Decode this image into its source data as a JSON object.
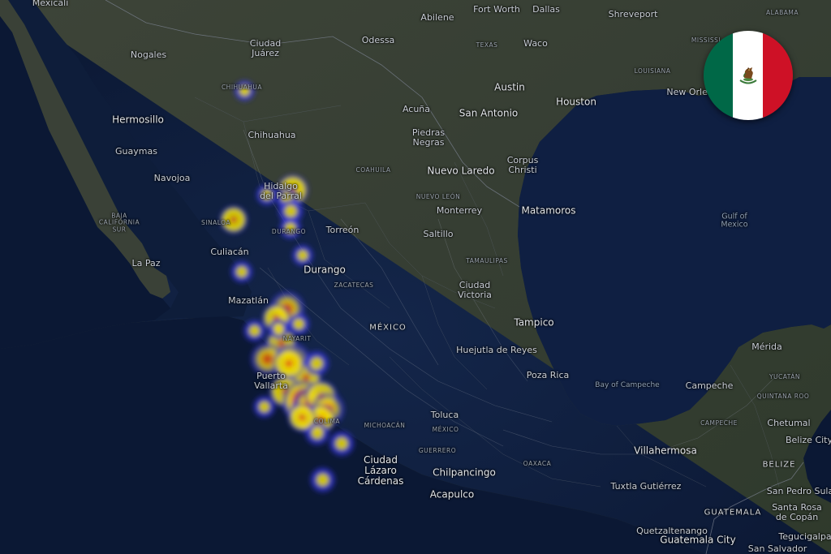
{
  "map": {
    "region": "Mexico",
    "flag": {
      "name": "mexico-flag",
      "colors": {
        "green": "#006847",
        "white": "#ffffff",
        "red": "#ce1126"
      }
    },
    "heat_colors": {
      "low": "#3535e0",
      "mid": "#f0e000",
      "high": "#e01818",
      "peak": "#8c0a18"
    },
    "labels": {
      "mexicali": "Mexicali",
      "odessa": "Odessa",
      "abilene": "Abilene",
      "fort_worth": "Fort Worth",
      "dallas": "Dallas",
      "shreveport": "Shreveport",
      "alabama": "ALABAMA",
      "mississippi": "MISSISSI",
      "texas": "TEXAS",
      "waco": "Waco",
      "louisiana": "LOUISIANA",
      "new_orleans": "New Orlea",
      "ciudad_juarez_1": "Ciudad",
      "ciudad_juarez_2": "Juárez",
      "nogales": "Nogales",
      "chihuahua_state": "CHIHUAHUA",
      "austin": "Austin",
      "houston": "Houston",
      "san_antonio": "San Antonio",
      "hermosillo": "Hermosillo",
      "chihuahua": "Chihuahua",
      "acuna": "Acuña",
      "piedras_negras_1": "Piedras",
      "piedras_negras_2": "Negras",
      "guaymas": "Guaymas",
      "navojoa": "Navojoa",
      "coahuila": "COAHUILA",
      "nuevo_laredo": "Nuevo Laredo",
      "corpus_christi_1": "Corpus",
      "corpus_christi_2": "Christi",
      "hidalgo_parral_1": "Hidalgo",
      "hidalgo_parral_2": "del Parral",
      "nuevo_leon": "NUEVO LEÓN",
      "monterrey": "Monterrey",
      "matamoros": "Matamoros",
      "baja_california_sur_1": "BAJA",
      "baja_california_sur_2": "CALIFORNIA",
      "baja_california_sur_3": "SUR",
      "sinaloa": "SINALOA",
      "torreon": "Torreón",
      "durango_state": "DURANGO",
      "saltillo": "Saltillo",
      "gulf_of_mexico_1": "Gulf of",
      "gulf_of_mexico_2": "Mexico",
      "culiacan": "Culiacán",
      "tamaulipas": "TAMAULIPAS",
      "la_paz": "La Paz",
      "durango": "Durango",
      "zacatecas": "ZACATECAS",
      "ciudad_victoria_1": "Ciudad",
      "ciudad_victoria_2": "Victoria",
      "mazatlan": "Mazatlán",
      "tampico": "Tampico",
      "mexico_country": "MÉXICO",
      "nayarit": "NAYARIT",
      "huejutla": "Huejutla de Reyes",
      "merida": "Mérida",
      "puerto_vallarta_1": "Puerto",
      "puerto_vallarta_2": "Vallarta",
      "poza_rica": "Poza Rica",
      "yucatan": "YUCATÁN",
      "bay_of_campeche": "Bay of Campeche",
      "campeche": "Campeche",
      "quintana_roo": "QUINTANA ROO",
      "toluca": "Toluca",
      "colima": "COLIMA",
      "michoacan": "MICHOACÁN",
      "mexico_state": "MÉXICO",
      "campeche_state": "CAMPECHE",
      "chetumal": "Chetumal",
      "belize_city": "Belize City",
      "guerrero": "GUERRERO",
      "villahermosa": "Villahermosa",
      "ciudad_lazaro_1": "Ciudad",
      "ciudad_lazaro_2": "Lázaro",
      "ciudad_lazaro_3": "Cárdenas",
      "chilpancingo": "Chilpancingo",
      "belize": "BELIZE",
      "tuxtla_gutierrez": "Tuxtla Gutiérrez",
      "acapulco": "Acapulco",
      "san_pedro_sula": "San Pedro Sula",
      "oaxaca": "OAXACA",
      "guatemala": "GUATEMALA",
      "santa_rosa_copan_1": "Santa Rosa",
      "santa_rosa_copan_2": "de Copán",
      "quetzaltenango": "Quetzaltenango",
      "guatemala_city": "Guatemala City",
      "tegucigalpa": "Tegucigalpa",
      "san_salvador": "San Salvador"
    }
  },
  "heat_points": [
    {
      "name": "chihuahua",
      "lon": -106.08,
      "lat": 28.63,
      "level": 0.1
    },
    {
      "name": "torreon",
      "lon": -103.42,
      "lat": 25.54,
      "level": 0.12
    },
    {
      "name": "monterrey",
      "lon": -100.32,
      "lat": 25.68,
      "level": 0.55
    },
    {
      "name": "saltillo",
      "lon": -100.99,
      "lat": 25.43,
      "level": 0.2
    },
    {
      "name": "monterrey-south",
      "lon": -100.55,
      "lat": 25.05,
      "level": 0.3
    },
    {
      "name": "linares",
      "lon": -100.6,
      "lat": 24.55,
      "level": 0.15
    },
    {
      "name": "culiacan",
      "lon": -107.39,
      "lat": 24.8,
      "level": 0.4
    },
    {
      "name": "mazatlan",
      "lon": -106.42,
      "lat": 23.25,
      "level": 0.15
    },
    {
      "name": "ciudad-victoria",
      "lon": -99.13,
      "lat": 23.74,
      "level": 0.12
    },
    {
      "name": "san-luis-potosi",
      "lon": -100.98,
      "lat": 22.15,
      "level": 0.75
    },
    {
      "name": "aguascalientes",
      "lon": -102.29,
      "lat": 21.88,
      "level": 0.4
    },
    {
      "name": "leon",
      "lon": -101.68,
      "lat": 21.12,
      "level": 0.55
    },
    {
      "name": "queretaro",
      "lon": -100.39,
      "lat": 20.59,
      "level": 0.88
    },
    {
      "name": "pachuca",
      "lon": -98.73,
      "lat": 20.1,
      "level": 0.55
    },
    {
      "name": "guadalajara",
      "lon": -103.35,
      "lat": 20.66,
      "level": 0.68
    },
    {
      "name": "tepic",
      "lon": -104.89,
      "lat": 21.5,
      "level": 0.15
    },
    {
      "name": "morelia",
      "lon": -101.19,
      "lat": 19.7,
      "level": 0.6
    },
    {
      "name": "colima",
      "lon": -103.72,
      "lat": 19.24,
      "level": 0.15
    },
    {
      "name": "toluca",
      "lon": -99.66,
      "lat": 19.29,
      "level": 0.5
    },
    {
      "name": "mexico-city",
      "lon": -99.13,
      "lat": 19.43,
      "level": 1.0
    },
    {
      "name": "puebla",
      "lon": -98.21,
      "lat": 19.04,
      "level": 0.98
    },
    {
      "name": "tlaxcala",
      "lon": -98.24,
      "lat": 19.32,
      "level": 0.75
    },
    {
      "name": "xalapa",
      "lon": -96.91,
      "lat": 19.54,
      "level": 0.6
    },
    {
      "name": "veracruz",
      "lon": -96.13,
      "lat": 19.17,
      "level": 0.7
    },
    {
      "name": "cordoba",
      "lon": -96.93,
      "lat": 18.88,
      "level": 0.45
    },
    {
      "name": "poza-rica",
      "lon": -97.46,
      "lat": 20.53,
      "level": 0.3
    },
    {
      "name": "tehuacan",
      "lon": -97.39,
      "lat": 18.46,
      "level": 0.25
    },
    {
      "name": "coatzacoalcos",
      "lon": -94.46,
      "lat": 18.15,
      "level": 0.3
    },
    {
      "name": "oaxaca",
      "lon": -96.73,
      "lat": 17.07,
      "level": 0.3
    },
    {
      "name": "cuernavaca",
      "lon": -99.23,
      "lat": 18.92,
      "level": 0.4
    },
    {
      "name": "celaya",
      "lon": -100.81,
      "lat": 20.52,
      "level": 0.55
    },
    {
      "name": "tampico-inland",
      "lon": -99.6,
      "lat": 21.7,
      "level": 0.15
    },
    {
      "name": "zacatecas-area",
      "lon": -102.0,
      "lat": 21.55,
      "level": 0.12
    }
  ]
}
